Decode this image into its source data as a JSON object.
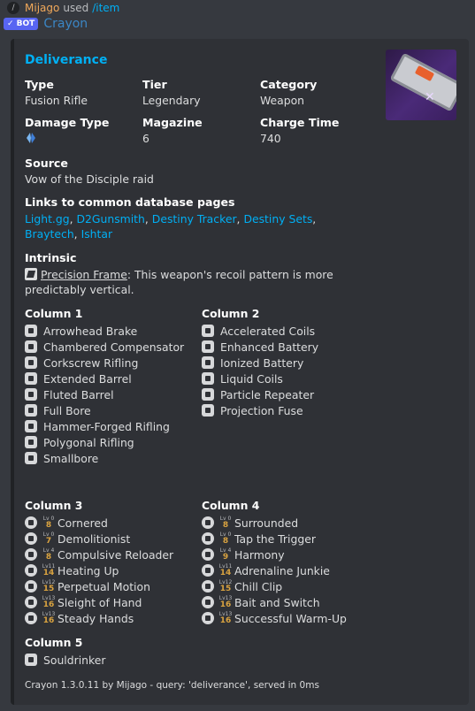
{
  "reply": {
    "user": "Mijago",
    "text": "used",
    "command": "/item"
  },
  "author": {
    "tag": "✓ BOT",
    "name": "Crayon"
  },
  "embed": {
    "title": "Deliverance",
    "fields": [
      {
        "name": "Type",
        "value": "Fusion Rifle"
      },
      {
        "name": "Tier",
        "value": "Legendary"
      },
      {
        "name": "Category",
        "value": "Weapon"
      },
      {
        "name": "Damage Type",
        "value": "",
        "icon": "arc-damage-icon"
      },
      {
        "name": "Magazine",
        "value": "6"
      },
      {
        "name": "Charge Time",
        "value": "740"
      }
    ],
    "source": {
      "name": "Source",
      "value": "Vow of the Disciple raid"
    },
    "links": {
      "name": "Links to common database pages",
      "items": [
        "Light.gg",
        "D2Gunsmith",
        "Destiny Tracker",
        "Destiny Sets",
        "Braytech",
        "Ishtar"
      ]
    },
    "intrinsic": {
      "name": "Intrinsic",
      "perk": "Precision Frame",
      "desc": ": This weapon's recoil pattern is more predictably vertical."
    },
    "columns": [
      {
        "title": "Column 1",
        "perks": [
          "Arrowhead Brake",
          "Chambered Compensator",
          "Corkscrew Rifling",
          "Extended Barrel",
          "Fluted Barrel",
          "Full Bore",
          "Hammer-Forged Rifling",
          "Polygonal Rifling",
          "Smallbore"
        ]
      },
      {
        "title": "Column 2",
        "perks": [
          "Accelerated Coils",
          "Enhanced Battery",
          "Ionized Battery",
          "Liquid Coils",
          "Particle Repeater",
          "Projection Fuse"
        ]
      },
      {
        "title": "Column 3",
        "perks": [
          {
            "lvTop": "Lv 0",
            "lvBot": "8",
            "name": "Cornered"
          },
          {
            "lvTop": "Lv 0",
            "lvBot": "7",
            "name": "Demolitionist"
          },
          {
            "lvTop": "Lv 4",
            "lvBot": "8",
            "name": "Compulsive Reloader"
          },
          {
            "lvTop": "Lv11",
            "lvBot": "14",
            "name": "Heating Up"
          },
          {
            "lvTop": "Lv12",
            "lvBot": "15",
            "name": "Perpetual Motion"
          },
          {
            "lvTop": "Lv13",
            "lvBot": "16",
            "name": "Sleight of Hand"
          },
          {
            "lvTop": "Lv13",
            "lvBot": "16",
            "name": "Steady Hands"
          }
        ]
      },
      {
        "title": "Column 4",
        "perks": [
          {
            "lvTop": "Lv 0",
            "lvBot": "8",
            "name": "Surrounded"
          },
          {
            "lvTop": "Lv 0",
            "lvBot": "8",
            "name": "Tap the Trigger"
          },
          {
            "lvTop": "Lv 4",
            "lvBot": "9",
            "name": "Harmony"
          },
          {
            "lvTop": "Lv11",
            "lvBot": "14",
            "name": "Adrenaline Junkie"
          },
          {
            "lvTop": "Lv12",
            "lvBot": "15",
            "name": "Chill Clip"
          },
          {
            "lvTop": "Lv13",
            "lvBot": "16",
            "name": "Bait and Switch"
          },
          {
            "lvTop": "Lv13",
            "lvBot": "16",
            "name": "Successful Warm-Up"
          }
        ]
      },
      {
        "title": "Column 5",
        "perks": [
          "Souldrinker"
        ]
      }
    ],
    "footer": "Crayon 1.3.0.11 by Mijago - query: 'deliverance', served in 0ms"
  },
  "colors": {
    "accent": "#00b0f4",
    "link": "#00aff4",
    "level": "#d9a340",
    "bot": "#5865f2"
  }
}
